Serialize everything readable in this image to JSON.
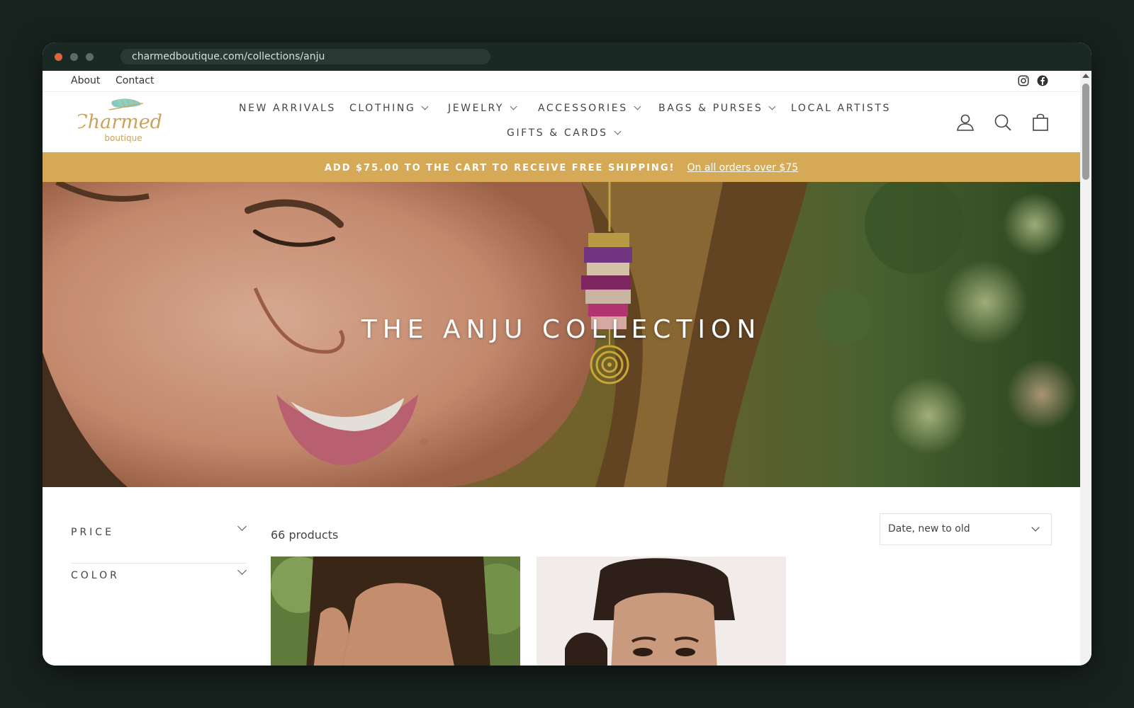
{
  "browser": {
    "url": "charmedboutique.com/collections/anju"
  },
  "utility_bar": {
    "about": "About",
    "contact": "Contact",
    "social_icons": [
      "instagram-icon",
      "facebook-icon"
    ]
  },
  "header": {
    "logo_main": "Charmed",
    "logo_sub": "boutique",
    "nav": {
      "new_arrivals": "NEW ARRIVALS",
      "clothing": "CLOTHING",
      "jewelry": "JEWELRY",
      "accessories": "ACCESSORIES",
      "bags_purses": "BAGS & PURSES",
      "local_artists": "LOCAL ARTISTS",
      "gifts_cards": "GIFTS & CARDS"
    },
    "icons": [
      "account-icon",
      "search-icon",
      "cart-icon"
    ]
  },
  "promo": {
    "message": "ADD $75.00 TO THE CART TO RECEIVE FREE SHIPPING!",
    "link": "On all orders over $75"
  },
  "hero": {
    "title": "THE ANJU COLLECTION"
  },
  "filters": {
    "price": "PRICE",
    "color": "COLOR"
  },
  "products": {
    "count_label": "66 products",
    "sort_selected": "Date, new to old"
  },
  "colors": {
    "promo": "#d6a957",
    "window": "#1b2924",
    "background": "#17221f"
  }
}
